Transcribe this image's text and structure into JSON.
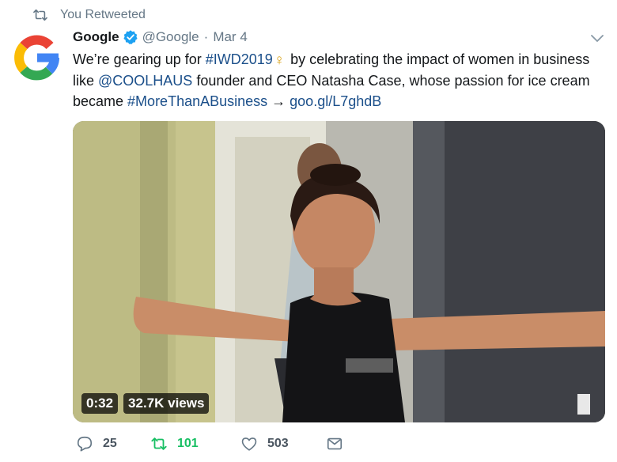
{
  "retweet_context": {
    "text": "You Retweeted",
    "icon": "retweet-icon"
  },
  "tweet": {
    "author": {
      "display_name": "Google",
      "handle": "@Google",
      "verified": true,
      "avatar_icon": "google-g-logo"
    },
    "date": "Mar 4",
    "separator": "·",
    "text_parts": {
      "t1": "We’re gearing up for ",
      "hashtag1": "#IWD2019",
      "venus": "♀",
      "t2": " by celebrating the impact of women in business like ",
      "mention": "@COOLHAUS",
      "t3": " founder and CEO Natasha Case, whose passion for ice cream became ",
      "hashtag2": "#MoreThanABusiness",
      "t4": " → ",
      "url": "goo.gl/L7ghdB"
    },
    "media": {
      "type": "video",
      "duration": "0:32",
      "views": "32.7K views"
    },
    "actions": {
      "replies": "25",
      "retweets": "101",
      "likes": "503",
      "retweeted": true
    }
  },
  "colors": {
    "text_primary": "#14171a",
    "text_secondary": "#657786",
    "link": "#1b4f8a",
    "verified": "#1da1f2",
    "retweet_active": "#17bf63",
    "venus_emoji": "#d9a31a",
    "google_blue": "#4285f4",
    "google_red": "#ea4335",
    "google_yellow": "#fbbc05",
    "google_green": "#34a853"
  }
}
